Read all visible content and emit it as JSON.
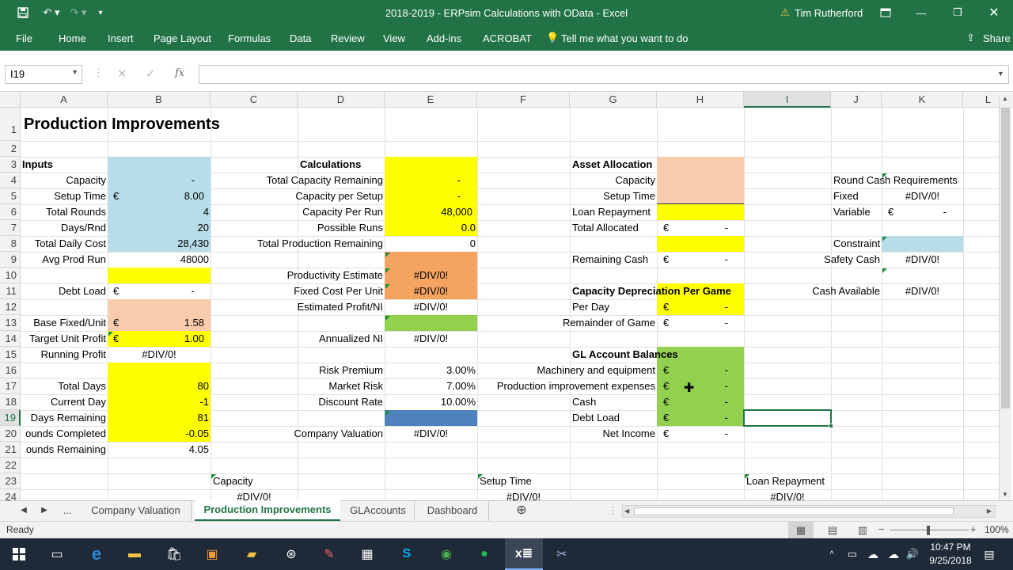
{
  "window": {
    "title": "2018-2019 - ERPsim Calculations with OData  -  Excel",
    "user": "Tim Rutherford"
  },
  "ribbon": {
    "tabs": [
      "File",
      "Home",
      "Insert",
      "Page Layout",
      "Formulas",
      "Data",
      "Review",
      "View",
      "Add-ins",
      "ACROBAT"
    ],
    "tell_me": "Tell me what you want to do",
    "share": "Share"
  },
  "formula_bar": {
    "name_box": "I19",
    "value": ""
  },
  "columns": [
    "A",
    "B",
    "C",
    "D",
    "E",
    "F",
    "G",
    "H",
    "I",
    "J",
    "K",
    "L"
  ],
  "rows": [
    "1",
    "2",
    "3",
    "4",
    "5",
    "6",
    "7",
    "8",
    "9",
    "10",
    "11",
    "12",
    "13",
    "14",
    "15",
    "16",
    "17",
    "18",
    "19",
    "20",
    "21",
    "22",
    "23",
    "24"
  ],
  "cells": {
    "A1": "Production Improvements",
    "A3": "Inputs",
    "A4": "Capacity",
    "B4": "-",
    "A5": "Setup Time",
    "B5_cur": "€",
    "B5": "8.00",
    "A6": "Total Rounds",
    "B6": "4",
    "A7": "Days/Rnd",
    "B7": "20",
    "A8": "Total Daily Cost",
    "B8": "28,430",
    "A9": "Avg Prod Run",
    "B9": "48000",
    "A11": "Debt Load",
    "B11_cur": "€",
    "B11": "-",
    "A13": "Base Fixed/Unit",
    "B13_cur": "€",
    "B13": "1.58",
    "A14": "Target Unit Profit",
    "B14_cur": "€",
    "B14": "1.00",
    "A15": "Running Profit",
    "B15": "#DIV/0!",
    "A17": "Total Days",
    "B17": "80",
    "A18": "Current Day",
    "B18": "-1",
    "A19": "Days Remaining",
    "B19": "81",
    "A20": "ounds Completed",
    "B20": "-0.05",
    "A21": "ounds Remaining",
    "B21": "4.05",
    "D3": "Calculations",
    "D4": "Total Capacity Remaining",
    "E4": "-",
    "D5": "Capacity per Setup",
    "E5": "-",
    "D6": "Capacity Per  Run",
    "E6": "48,000",
    "D7": "Possible Runs",
    "E7": "0.0",
    "D8": "Total Production Remaining",
    "E8": "0",
    "D10": "Productivity Estimate",
    "E10": "#DIV/0!",
    "D11": "Fixed Cost Per Unit",
    "E11": "#DIV/0!",
    "D12": "Estimated Profit/NI",
    "E12": "#DIV/0!",
    "D14": "Annualized NI",
    "E14": "#DIV/0!",
    "D16": "Risk Premium",
    "E16": "3.00%",
    "D17": "Market Risk",
    "E17": "7.00%",
    "D18": "Discount Rate",
    "E18": "10.00%",
    "D20": "Company Valuation",
    "E20": "#DIV/0!",
    "G3": "Asset Allocation",
    "G4": "Capacity",
    "G5": "Setup Time",
    "G6": "Loan Repayment",
    "G7": "Total Allocated",
    "H7_cur": "€",
    "H7": "-",
    "G9": "Remaining Cash",
    "H9_cur": "€",
    "H9": "-",
    "G11": "Capacity Depreciation Per Game",
    "G12": "Per Day",
    "H12_cur": "€",
    "H12": "-",
    "G13": "Remainder of Game",
    "H13_cur": "€",
    "H13": "-",
    "G15": "GL Account Balances",
    "G16": "Machinery and equipment",
    "H16_cur": "€",
    "H16": "-",
    "G17": "Production improvement expenses",
    "H17_cur": "€",
    "H17": "-",
    "G18": "Cash",
    "H18_cur": "€",
    "H18": "-",
    "G19": "Debt Load",
    "H19_cur": "€",
    "H19": "-",
    "G20": "Net Income",
    "H20_cur": "€",
    "H20": "-",
    "J4": "Round Cash Requirements",
    "J5": "Fixed",
    "K5": "#DIV/0!",
    "J6": "Variable",
    "K6_cur": "€",
    "K6": "-",
    "J8": "Constraint",
    "J9": "Safety Cash",
    "K9": "#DIV/0!",
    "J11": "Cash Available",
    "K11": "#DIV/0!",
    "C23": "Capacity",
    "C24": "#DIV/0!",
    "F23": "Setup Time",
    "F24": "#DIV/0!",
    "I23": "Loan Repayment",
    "I24": "#DIV/0!"
  },
  "sheet_tabs": {
    "more": "...",
    "tabs": [
      "Company Valuation",
      "Production Improvements",
      "GLAccounts",
      "Dashboard"
    ],
    "active": "Production Improvements"
  },
  "status": {
    "text": "Ready",
    "zoom": "100%"
  },
  "taskbar": {
    "time": "10:47 PM",
    "date": "9/25/2018"
  },
  "colors": {
    "excel_green": "#217346",
    "yellow": "#ffff00",
    "lightblue": "#b7dee8",
    "peach": "#f8cbad",
    "orange": "#f4a460",
    "green": "#92d050",
    "blue": "#4f81bd"
  }
}
